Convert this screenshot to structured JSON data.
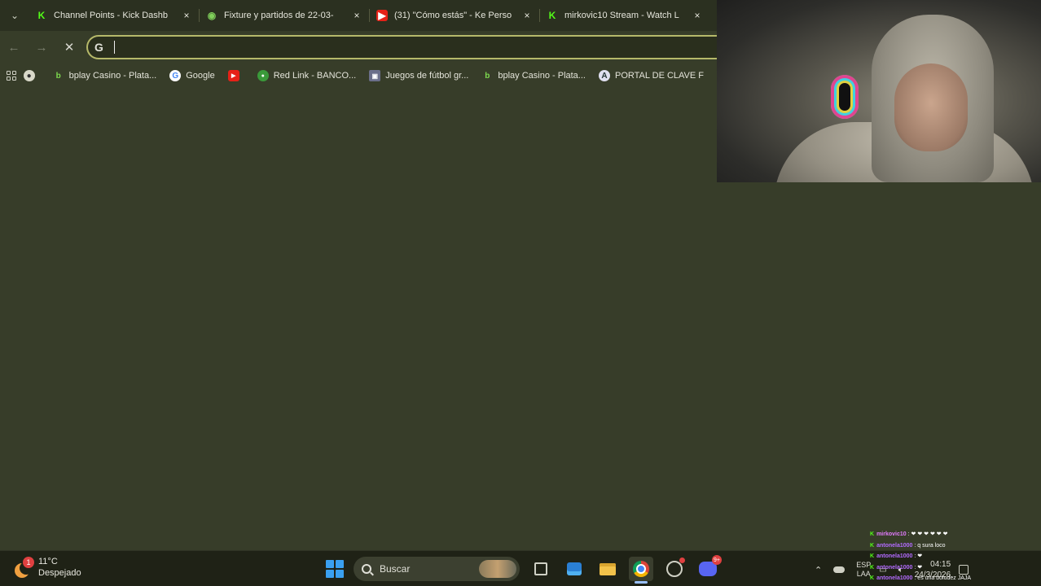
{
  "browser": {
    "tabs": [
      {
        "title": "Channel Points - Kick Dashb",
        "icon": "kick-icon"
      },
      {
        "title": "Fixture y partidos de 22-03-",
        "icon": "globe-icon"
      },
      {
        "title": "(31) \"Cómo estás\" - Ke Perso",
        "icon": "youtube-icon"
      },
      {
        "title": "mirkovic10 Stream - Watch L",
        "icon": "kick-icon"
      }
    ],
    "close_glyph": "×",
    "omnibox": {
      "engine_icon": "G",
      "value": "",
      "placeholder": ""
    },
    "bookmarks": [
      {
        "label": "",
        "icon": "soccer-ball-icon"
      },
      {
        "label": "bplay Casino - Plata...",
        "icon": "bplay-icon"
      },
      {
        "label": "Google",
        "icon": "google-icon"
      },
      {
        "label": "",
        "icon": "youtube-icon"
      },
      {
        "label": "Red Link - BANCO...",
        "icon": "redlink-icon"
      },
      {
        "label": "Juegos de fútbol gr...",
        "icon": "juegos-icon"
      },
      {
        "label": "bplay Casino - Plata...",
        "icon": "bplay-icon"
      },
      {
        "label": "PORTAL DE CLAVE F",
        "icon": "portal-icon"
      }
    ]
  },
  "chat": {
    "messages": [
      {
        "user": "mirkovic10",
        "text": ": ❤ ❤ ❤ ❤ ❤ ❤"
      },
      {
        "user": "antonela1000",
        "text": ": q sura loco"
      },
      {
        "user": "antonela1000",
        "text": ": ❤"
      },
      {
        "user": "antonela1000",
        "text": ": ❤"
      },
      {
        "user": "antonela1000",
        "text": ": es una boludez JAJA"
      }
    ]
  },
  "taskbar": {
    "weather": {
      "temp": "11°C",
      "condition": "Despejado",
      "badge": "1"
    },
    "search_label": "Buscar",
    "discord_badge": "9+",
    "tray": {
      "lang_top": "ESP",
      "lang_bottom": "LAA",
      "time": "04:15",
      "date": "24/3/2026"
    }
  },
  "colors": {
    "page_bg": "#373d29",
    "taskbar_bg": "#1f2216",
    "omnibox_border": "#b6b96a",
    "kick_green": "#53fc18"
  }
}
